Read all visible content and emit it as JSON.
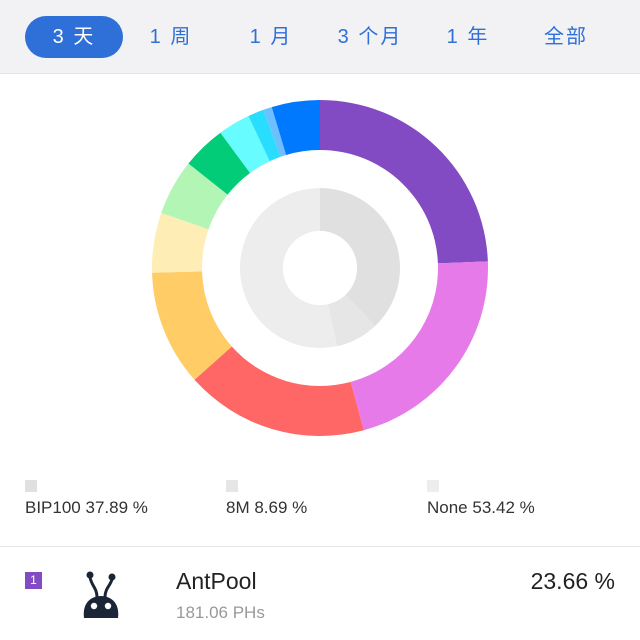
{
  "tabs": {
    "items": [
      "3 天",
      "1 周",
      "1 月",
      "3 个月",
      "1 年",
      "全部"
    ],
    "active": 0
  },
  "chart_data": {
    "type": "pie",
    "outer_ring": {
      "values": [
        23.66,
        20.8,
        17.1,
        10.8,
        5.6,
        5.2,
        4.1,
        3.0,
        1.5,
        0.8,
        4.5
      ],
      "colors": [
        "#834bc3",
        "#e57ae8",
        "#ff6766",
        "#ffcc66",
        "#ffedb6",
        "#b2f5b5",
        "#02cc77",
        "#67fcff",
        "#29ddff",
        "#6ebfff",
        "#0079fe"
      ]
    },
    "inner_ring": {
      "categories": [
        "BIP100",
        "8M",
        "None"
      ],
      "values": [
        37.89,
        8.69,
        53.42
      ],
      "colors": [
        "#e0e0e0",
        "#e6e6e6",
        "#ededed"
      ]
    },
    "legend": [
      {
        "label": "BIP100 37.89 %",
        "color": "#e0e0e0"
      },
      {
        "label": "8M 8.69 %",
        "color": "#e6e6e6"
      },
      {
        "label": "None 53.42 %",
        "color": "#ededed"
      }
    ]
  },
  "pool": {
    "rank": "1",
    "rank_color": "#834bc3",
    "name": "AntPool",
    "hashrate": "181.06 PHs",
    "percent": "23.66 %"
  }
}
